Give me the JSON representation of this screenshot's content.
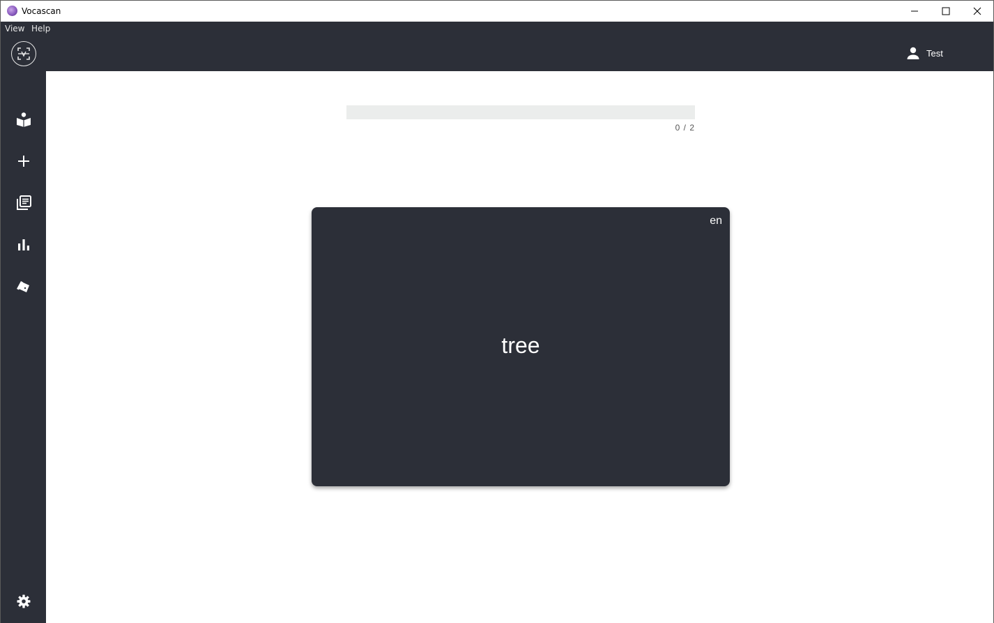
{
  "window": {
    "title": "Vocascan"
  },
  "menu": {
    "items": [
      {
        "label": "View"
      },
      {
        "label": "Help"
      }
    ]
  },
  "header": {
    "user_name": "Test",
    "icons": {
      "logo": "scan-logo-icon",
      "user": "person-icon"
    }
  },
  "sidebar": {
    "items": [
      {
        "icon": "book-reader-icon"
      },
      {
        "icon": "plus-icon"
      },
      {
        "icon": "library-icon"
      },
      {
        "icon": "bar-chart-icon"
      },
      {
        "icon": "cards-icon"
      },
      {
        "icon": "gear-icon"
      }
    ]
  },
  "progress": {
    "current": 0,
    "total": 2,
    "text": "0 / 2"
  },
  "card": {
    "language": "en",
    "word": "tree"
  },
  "colors": {
    "dark": "#2c2f38",
    "progress_track": "#ebedec",
    "text_light": "#ffffff"
  }
}
